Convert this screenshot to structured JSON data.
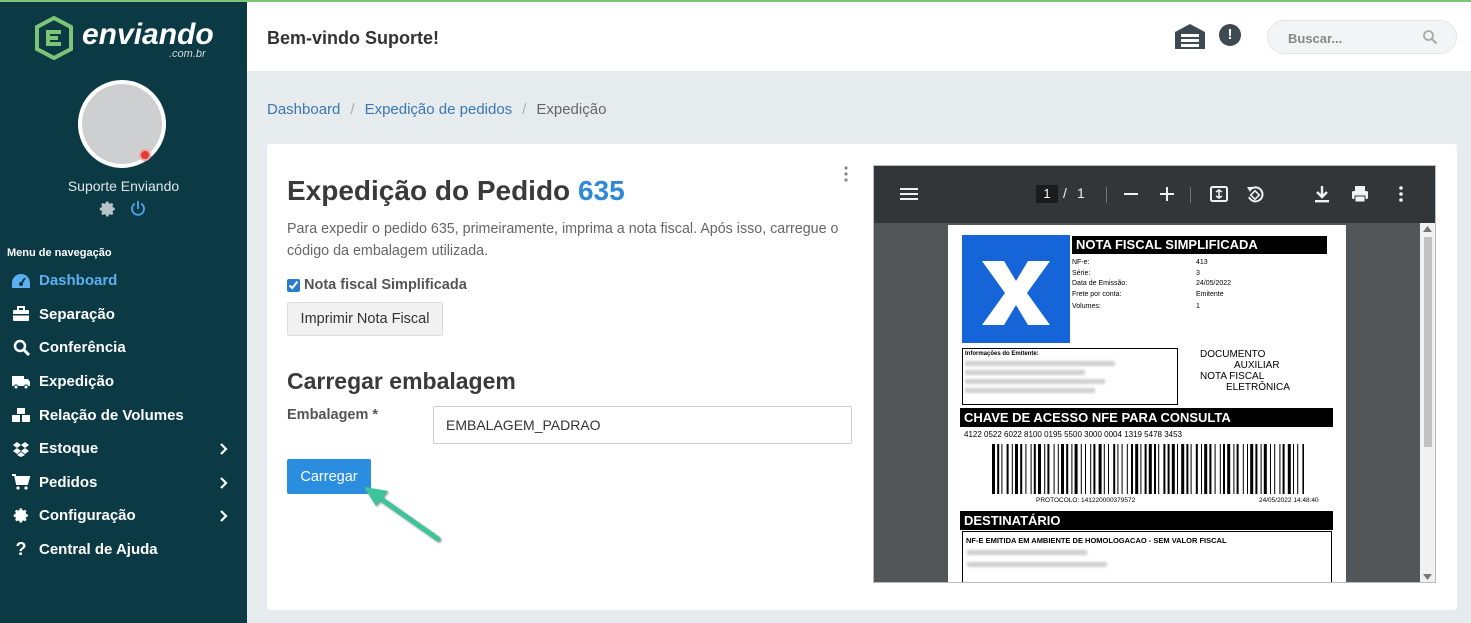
{
  "brand": {
    "name": "enviando",
    "domain": ".com.br"
  },
  "user": {
    "name": "Suporte Enviando"
  },
  "nav": {
    "title": "Menu de navegação",
    "items": [
      {
        "label": "Dashboard",
        "icon": "dashboard-icon",
        "active": true
      },
      {
        "label": "Separação",
        "icon": "briefcase-icon"
      },
      {
        "label": "Conferência",
        "icon": "search-icon"
      },
      {
        "label": "Expedição",
        "icon": "truck-icon"
      },
      {
        "label": "Relação de Volumes",
        "icon": "boxes-icon"
      },
      {
        "label": "Estoque",
        "icon": "dropbox-icon",
        "has_submenu": true
      },
      {
        "label": "Pedidos",
        "icon": "cart-icon",
        "has_submenu": true
      },
      {
        "label": "Configuração",
        "icon": "gear-icon",
        "has_submenu": true
      },
      {
        "label": "Central de Ajuda",
        "icon": "question-icon"
      }
    ]
  },
  "header": {
    "welcome": "Bem-vindo Suporte!",
    "search_placeholder": "Buscar..."
  },
  "breadcrumb": [
    "Dashboard",
    "Expedição de pedidos",
    "Expedição"
  ],
  "main": {
    "title_prefix": "Expedição do Pedido",
    "order_number": "635",
    "description": "Para expedir o pedido 635, primeiramente, imprima a nota fiscal. Após isso, carregue o código da embalagem utilizada.",
    "checkbox_label": "Nota fiscal Simplificada",
    "checkbox_checked": true,
    "print_button": "Imprimir Nota Fiscal",
    "section_title": "Carregar embalagem",
    "field_label": "Embalagem *",
    "field_value": "EMBALAGEM_PADRAO",
    "submit_button": "Carregar"
  },
  "pdf_viewer": {
    "page_current": "1",
    "page_separator": "/",
    "page_total": "1",
    "document": {
      "title": "NOTA FISCAL SIMPLIFICADA",
      "meta": [
        {
          "label": "NF-e:",
          "value": "413"
        },
        {
          "label": "Série:",
          "value": "3"
        },
        {
          "label": "Data de Emissão:",
          "value": "24/05/2022"
        },
        {
          "label": "Frete por conta:",
          "value": "Emitente"
        },
        {
          "label": "Volumes:",
          "value": "1"
        }
      ],
      "emitente_label": "Informações do Emitente:",
      "doc_lines": [
        "DOCUMENTO",
        "AUXILIAR",
        "NOTA FISCAL",
        "ELETRÔNICA"
      ],
      "chave_title": "CHAVE DE ACESSO NFE PARA CONSULTA",
      "chave": "4122 0522 6022 8100 0195 5500 3000 0004 1319 5478 3453",
      "protocolo": "PROTOCOLO: 141220000379572",
      "protocolo_date": "24/05/2022 14:48:40",
      "destinatario_title": "DESTINATÁRIO",
      "homologacao": "NF-E EMITIDA EM AMBIENTE DE HOMOLOGACAO - SEM VALOR FISCAL"
    }
  },
  "colors": {
    "sidebar": "#0b3a45",
    "accent": "#2a8de0",
    "active_nav": "#5cb0f0",
    "brand_green": "#7cc576"
  }
}
